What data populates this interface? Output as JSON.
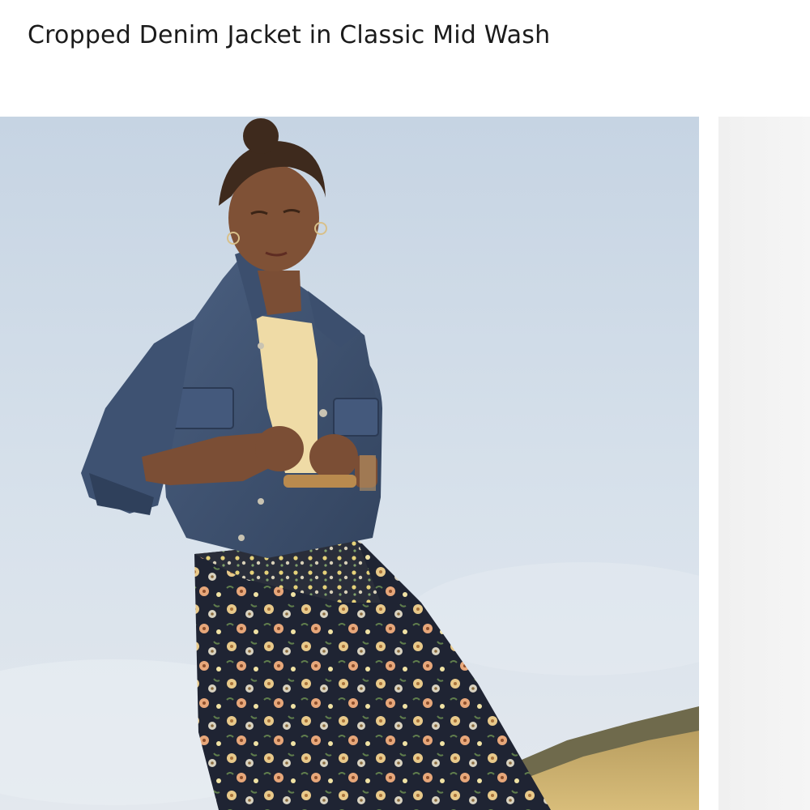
{
  "product": {
    "title": "Cropped Denim Jacket in Classic Mid Wash"
  },
  "gallery": {
    "active_index": 1
  },
  "colors": {
    "title_text": "#1b1b1b",
    "sky_top": "#c9d6e4",
    "sky_bottom": "#dfe6ee",
    "denim": "#3e5272",
    "skirt": "#1f2433",
    "field": "#c9ad6c"
  }
}
